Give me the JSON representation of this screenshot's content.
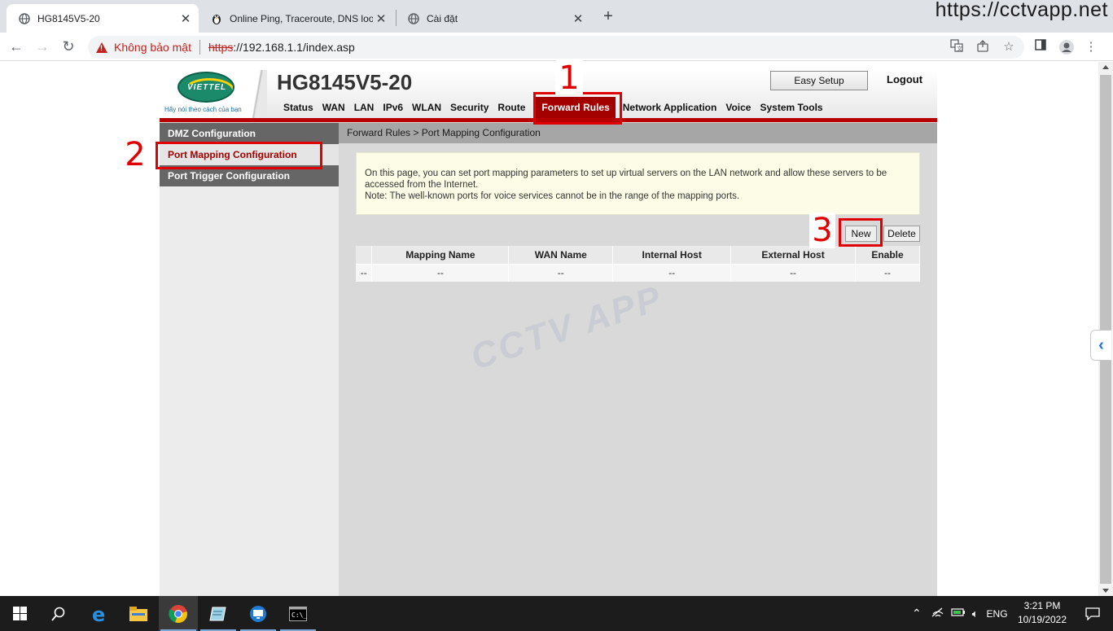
{
  "browser": {
    "tabs": [
      {
        "title": "HG8145V5-20",
        "active": true
      },
      {
        "title": "Online Ping, Traceroute, DNS look",
        "active": false
      },
      {
        "title": "Cài đặt",
        "active": false
      }
    ],
    "watermark": "https://cctvapp.net",
    "security_warning": "Không bảo mật",
    "url_scheme": "https",
    "url_rest": "://192.168.1.1/index.asp"
  },
  "router": {
    "logo_text": "VIETTEL",
    "slogan": "Hãy nói theo cách của bạn",
    "model": "HG8145V5-20",
    "easy_setup": "Easy Setup",
    "logout": "Logout",
    "menu": [
      "Status",
      "WAN",
      "LAN",
      "IPv6",
      "WLAN",
      "Security",
      "Route",
      "Forward Rules",
      "Network Application",
      "Voice",
      "System Tools"
    ],
    "menu_selected": "Forward Rules",
    "left_nav": [
      "DMZ Configuration",
      "Port Mapping Configuration",
      "Port Trigger Configuration"
    ],
    "breadcrumb": "Forward Rules > Port Mapping Configuration",
    "info_line1": "On this page, you can set port mapping parameters to set up virtual servers on the LAN network and allow these servers to be accessed from the Internet.",
    "info_line2": "Note: The well-known ports for voice services cannot be in the range of the mapping ports.",
    "btn_new": "New",
    "btn_delete": "Delete",
    "table": {
      "headers": [
        "",
        "Mapping Name",
        "WAN Name",
        "Internal Host",
        "External Host",
        "Enable"
      ],
      "rows": [
        [
          "--",
          "--",
          "--",
          "--",
          "--",
          "--"
        ]
      ]
    },
    "watermark": "CCTV APP"
  },
  "annotations": [
    "1",
    "2",
    "3"
  ],
  "taskbar": {
    "lang": "ENG",
    "time": "3:21 PM",
    "date": "10/19/2022"
  },
  "colors": {
    "menu_selected_bg": "#a30000",
    "annotation_red": "#e00000",
    "left_nav_dark": "#666666"
  }
}
